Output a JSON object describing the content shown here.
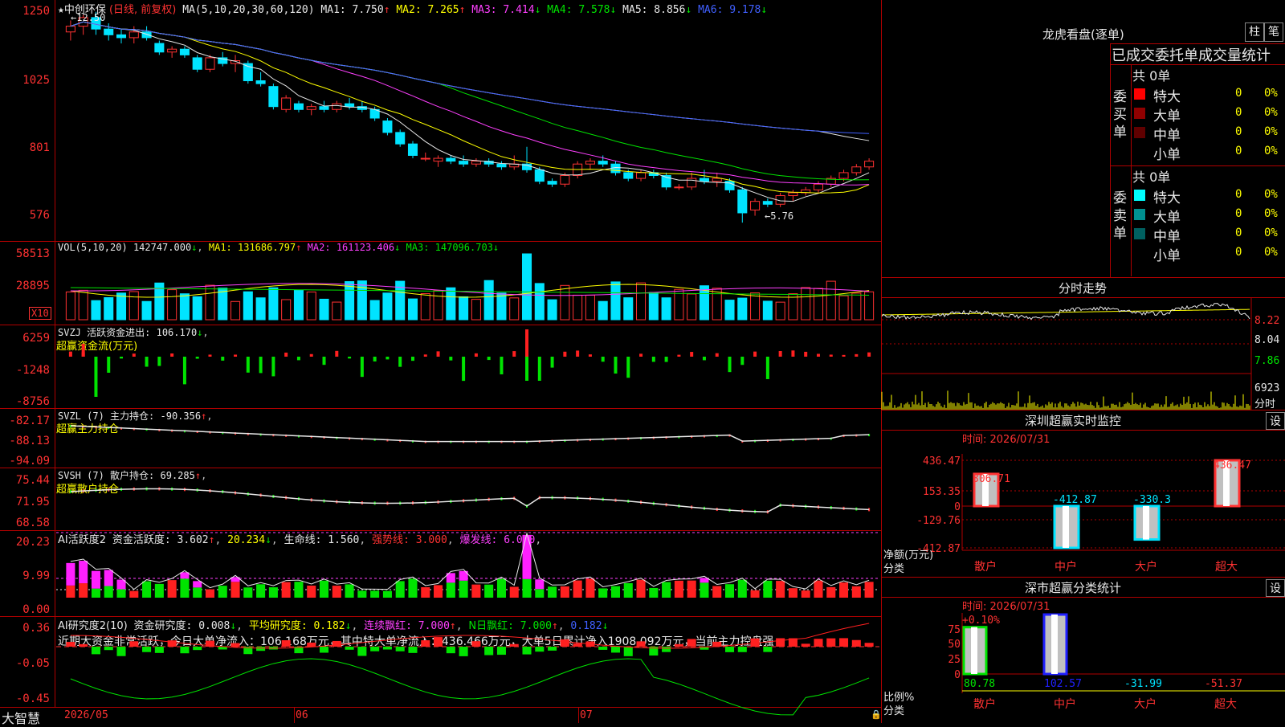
{
  "chart_data": [
    {
      "type": "candlestick",
      "title": "中创环保 (日线, 前复权)",
      "ma_label": "MA(5,10,20,30,60,120)",
      "ma_values": [
        {
          "name": "MA1",
          "value": "7.750",
          "arrow": "↑",
          "color": "#e8e8e8"
        },
        {
          "name": "MA2",
          "value": "7.265",
          "arrow": "↑",
          "color": "#ffff00"
        },
        {
          "name": "MA3",
          "value": "7.414",
          "arrow": "↓",
          "color": "#ff40ff"
        },
        {
          "name": "MA4",
          "value": "7.578",
          "arrow": "↓",
          "color": "#00e400"
        },
        {
          "name": "MA5",
          "value": "8.856",
          "arrow": "↓",
          "color": "#e8e8e8"
        },
        {
          "name": "MA6",
          "value": "9.178",
          "arrow": "↓",
          "color": "#4060ff"
        }
      ],
      "y_ticks": [
        "1250",
        "1025",
        "801",
        "576"
      ],
      "high_label": "←12.50",
      "low_label": "←5.76",
      "x_labels": [
        "2026/05",
        "06",
        "07"
      ],
      "candles": [
        [
          12.4,
          12.8,
          12.1,
          12.6
        ],
        [
          12.6,
          13.0,
          12.3,
          12.9
        ],
        [
          12.9,
          13.1,
          12.3,
          12.5
        ],
        [
          12.5,
          12.7,
          12.1,
          12.3
        ],
        [
          12.3,
          12.5,
          12.0,
          12.2
        ],
        [
          12.2,
          12.6,
          12.0,
          12.4
        ],
        [
          12.4,
          12.6,
          12.1,
          12.2
        ],
        [
          12.0,
          12.1,
          11.6,
          11.7
        ],
        [
          11.7,
          11.9,
          11.5,
          11.8
        ],
        [
          11.8,
          11.9,
          11.5,
          11.6
        ],
        [
          11.5,
          11.6,
          11.0,
          11.1
        ],
        [
          11.1,
          11.6,
          11.0,
          11.5
        ],
        [
          11.5,
          11.7,
          11.2,
          11.3
        ],
        [
          11.3,
          11.6,
          11.0,
          11.4
        ],
        [
          11.3,
          11.4,
          10.6,
          10.7
        ],
        [
          10.7,
          11.0,
          10.5,
          10.6
        ],
        [
          10.5,
          10.6,
          9.7,
          9.8
        ],
        [
          9.7,
          10.2,
          9.6,
          10.1
        ],
        [
          9.9,
          10.0,
          9.6,
          9.7
        ],
        [
          9.7,
          9.9,
          9.5,
          9.8
        ],
        [
          9.8,
          10.0,
          9.6,
          9.7
        ],
        [
          9.7,
          10.0,
          9.6,
          9.9
        ],
        [
          9.9,
          10.1,
          9.7,
          9.8
        ],
        [
          9.8,
          10.0,
          9.6,
          9.7
        ],
        [
          9.7,
          9.8,
          9.3,
          9.4
        ],
        [
          9.3,
          9.4,
          8.8,
          8.9
        ],
        [
          8.9,
          9.0,
          8.4,
          8.5
        ],
        [
          8.5,
          8.6,
          8.0,
          8.1
        ],
        [
          8.0,
          8.2,
          7.9,
          8.0
        ],
        [
          7.9,
          8.1,
          7.7,
          8.0
        ],
        [
          8.0,
          8.1,
          7.8,
          7.9
        ],
        [
          7.9,
          8.1,
          7.7,
          7.8
        ],
        [
          7.8,
          8.0,
          7.7,
          7.9
        ],
        [
          7.9,
          8.0,
          7.7,
          7.8
        ],
        [
          7.8,
          7.9,
          7.6,
          7.7
        ],
        [
          7.7,
          8.1,
          7.6,
          7.8
        ],
        [
          7.8,
          8.4,
          7.5,
          7.6
        ],
        [
          7.6,
          7.7,
          7.1,
          7.2
        ],
        [
          7.2,
          7.3,
          7.0,
          7.1
        ],
        [
          7.1,
          7.5,
          7.0,
          7.4
        ],
        [
          7.4,
          7.9,
          7.3,
          7.8
        ],
        [
          7.8,
          8.0,
          7.6,
          7.9
        ],
        [
          7.9,
          8.1,
          7.7,
          7.8
        ],
        [
          7.8,
          7.9,
          7.4,
          7.5
        ],
        [
          7.5,
          7.6,
          7.2,
          7.3
        ],
        [
          7.3,
          7.6,
          7.2,
          7.5
        ],
        [
          7.5,
          7.6,
          7.3,
          7.4
        ],
        [
          7.4,
          7.5,
          6.9,
          7.0
        ],
        [
          7.0,
          7.1,
          6.9,
          7.0
        ],
        [
          7.0,
          7.5,
          6.9,
          7.3
        ],
        [
          7.3,
          7.6,
          7.1,
          7.2
        ],
        [
          7.2,
          7.5,
          7.0,
          7.3
        ],
        [
          7.2,
          7.3,
          6.8,
          6.9
        ],
        [
          6.9,
          7.0,
          5.76,
          6.1
        ],
        [
          6.2,
          6.6,
          6.0,
          6.5
        ],
        [
          6.5,
          6.6,
          6.3,
          6.4
        ],
        [
          6.4,
          6.8,
          6.3,
          6.7
        ],
        [
          6.7,
          6.9,
          6.5,
          6.8
        ],
        [
          6.8,
          7.0,
          6.7,
          6.9
        ],
        [
          6.9,
          7.2,
          6.8,
          7.1
        ],
        [
          7.1,
          7.4,
          7.0,
          7.3
        ],
        [
          7.3,
          7.6,
          7.2,
          7.5
        ],
        [
          7.5,
          7.8,
          7.4,
          7.7
        ],
        [
          7.7,
          8.0,
          7.6,
          7.9
        ]
      ]
    },
    {
      "type": "bar",
      "title": "VOL(5,10,20)",
      "value": "142747.000",
      "ma_values": [
        {
          "name": "MA1",
          "value": "131686.797",
          "arrow": "↑",
          "color": "#ffff00"
        },
        {
          "name": "MA2",
          "value": "161123.406",
          "arrow": "↓",
          "color": "#ff40ff"
        },
        {
          "name": "MA3",
          "value": "147096.703",
          "arrow": "↓",
          "color": "#00e400"
        }
      ],
      "y_ticks": [
        "58513",
        "28895"
      ],
      "unit": "X10"
    },
    {
      "type": "bar",
      "name": "SVZJ",
      "label": "活跃资金进出",
      "value": "106.170",
      "arrow": "↓",
      "sub": "超赢资金流(万元)",
      "y_ticks": [
        "6259",
        "-1248",
        "-8756"
      ]
    },
    {
      "type": "line",
      "name": "SVZL (7)",
      "label": "主力持仓",
      "value": "-90.356",
      "arrow": "↑",
      "sub": "超赢主力持仓",
      "y_ticks": [
        "-82.17",
        "-88.13",
        "-94.09"
      ]
    },
    {
      "type": "line",
      "name": "SVSH (7)",
      "label": "散户持仓",
      "value": "69.285",
      "arrow": "↑",
      "sub": "超赢散户持仓",
      "y_ticks": [
        "75.44",
        "71.95",
        "68.58"
      ]
    },
    {
      "type": "bar",
      "name": "AI活跃度2",
      "label": "资金活跃度",
      "value1": "3.602",
      "value2": "20.234",
      "arrow1": "↑",
      "arrow2": "↓",
      "life": "生命线",
      "life_value": "1.560",
      "strong": "强势线",
      "strong_value": "3.000",
      "burst": "爆发线",
      "burst_value": "6.000",
      "y_ticks": [
        "20.23",
        "9.99",
        "0.00"
      ]
    },
    {
      "type": "bar",
      "name": "AI研究度2(10)",
      "label": "资金研究度",
      "value": "0.008",
      "arrow": "↓",
      "avg": "平均研究度",
      "avg_value": "0.182",
      "avg_arrow": "↓",
      "cont": "连续飘红",
      "cont_value": "7.000",
      "cont_arrow": "↑",
      "nday": "N日飘红",
      "nday_value": "7.000",
      "nday_arrow": "↑",
      "last_value": "0.182",
      "last_arrow": "↓",
      "summary": "近期大资金非常活跃，今日大单净流入：106.168万元，其中特大单净流入：436.466万元，大单5日累计净入1908.092万元，当前主力控盘强",
      "y_ticks": [
        "0.36",
        "-0.05",
        "-0.45"
      ]
    }
  ],
  "footer": {
    "brand": "大智慧"
  },
  "right_panel": {
    "dragon_title": "龙虎看盘(逐单)",
    "btn_col": "柱",
    "btn_pen": "笔",
    "header": "已成交委托单成交量统计",
    "buy_total": "共 0单",
    "sell_total": "共 0单",
    "buy_label": "委买单",
    "sell_label": "委卖单",
    "buy_rows": [
      {
        "name": "特大",
        "count": "0",
        "pct": "0%",
        "color": "#ff0000"
      },
      {
        "name": "大单",
        "count": "0",
        "pct": "0%",
        "color": "#900000"
      },
      {
        "name": "中单",
        "count": "0",
        "pct": "0%",
        "color": "#600000"
      },
      {
        "name": "小单",
        "count": "0",
        "pct": "0%",
        "color": "#000000"
      }
    ],
    "sell_rows": [
      {
        "name": "特大",
        "count": "0",
        "pct": "0%",
        "color": "#00ffff"
      },
      {
        "name": "大单",
        "count": "0",
        "pct": "0%",
        "color": "#009090"
      },
      {
        "name": "中单",
        "count": "0",
        "pct": "0%",
        "color": "#006060"
      },
      {
        "name": "小单",
        "count": "0",
        "pct": "0%",
        "color": "#000000"
      }
    ],
    "intraday_title": "分时走势",
    "intraday_ticks": [
      "8.22",
      "8.04",
      "7.86",
      "6923"
    ],
    "intraday_time_label": "分时",
    "monitor_title": "深圳超赢实时监控",
    "settings": "设",
    "monitor_time": "时间: 2026/07/31",
    "monitor_ticks": [
      "436.47",
      "153.35",
      "0",
      "-129.76",
      "-412.87"
    ],
    "monitor_bars": [
      {
        "name": "散户",
        "value": 306.71,
        "label": "306.71",
        "color": "#ff3232"
      },
      {
        "name": "中户",
        "value": -412.87,
        "label": "-412.87",
        "color": "#00e4ff"
      },
      {
        "name": "大户",
        "value": -330.3,
        "label": "-330.3",
        "color": "#00e4ff"
      },
      {
        "name": "超大",
        "value": 436.47,
        "label": "436.47",
        "color": "#ff3232"
      }
    ],
    "monitor_ylabel": "净额(万元)",
    "monitor_xlabel": "分类",
    "class_title": "深市超赢分类统计",
    "class_time": "时间: 2026/07/31",
    "class_ticks": [
      "75",
      "50",
      "25",
      "0"
    ],
    "class_top_label": "+0.10%",
    "class_bars": [
      {
        "name": "散户",
        "value": 80.78,
        "label": "80.78",
        "color": "#00e400"
      },
      {
        "name": "中户",
        "value": 102.57,
        "label": "102.57",
        "color": "#2020ff"
      },
      {
        "name": "大户",
        "value": -31.99,
        "label": "-31.99",
        "color": "#00e4ff"
      },
      {
        "name": "超大",
        "value": -51.37,
        "label": "-51.37",
        "color": "#ff3232"
      }
    ],
    "class_ylabel": "比例%",
    "class_xlabel": "分类"
  }
}
